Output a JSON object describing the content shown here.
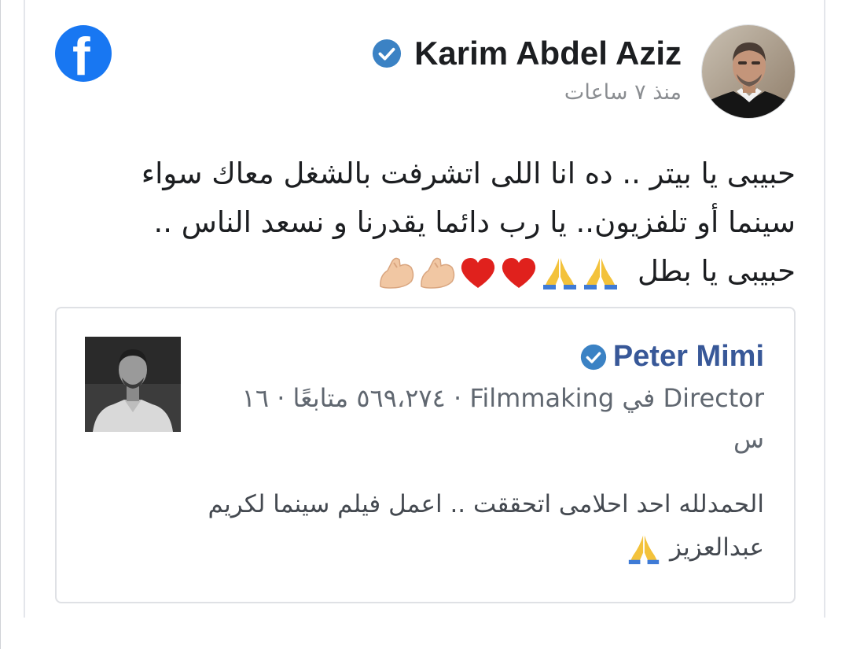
{
  "post": {
    "author": "Karim Abdel Aziz",
    "time": "منذ ٧ ساعات",
    "lines": [
      "حبيبى يا بيتر .. ده انا اللى اتشرفت بالشغل معاك سواء",
      "سينما أو تلفزيون.. يا رب دائما يقدرنا و نسعد الناس ..",
      "حبيبى يا بطل"
    ],
    "emojis": [
      "folded-hands-icon",
      "folded-hands-icon",
      "red-heart-icon",
      "red-heart-icon",
      "flexed-biceps-icon",
      "flexed-biceps-icon"
    ]
  },
  "shared_post": {
    "author": "Peter Mimi",
    "meta_line1": "Director في Filmmaking · ٥٦٩،٢٧٤ متابعًا · ١٦",
    "meta_line2": "س",
    "text_line1": "الحمدلله احد احلامى اتحققت .. اعمل فيلم سينما لكريم",
    "text_line2": "عبدالعزيز"
  },
  "colors": {
    "facebook_blue": "#1877f2",
    "link_name": "#385898",
    "verified": "#3b82c4",
    "heart": "#e0211d"
  }
}
